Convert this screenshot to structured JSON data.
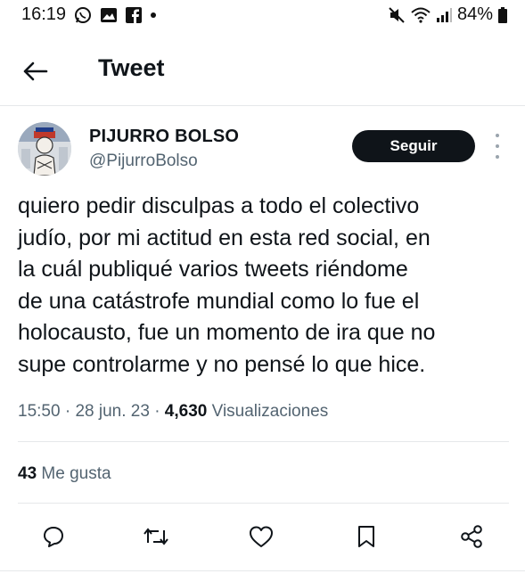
{
  "status_bar": {
    "time": "16:19",
    "left_icons": [
      "whatsapp-icon",
      "gallery-icon",
      "facebook-icon",
      "dot-icon"
    ],
    "right_icons": [
      "mute-icon",
      "wifi-icon",
      "signal-icon"
    ],
    "battery": "84%"
  },
  "header": {
    "title": "Tweet"
  },
  "author": {
    "display_name": "PIJURRO BOLSO",
    "handle": "@PijurroBolso",
    "follow_label": "Seguir"
  },
  "tweet": {
    "lines": [
      "quiero pedir disculpas a todo el colectivo",
      "judío, por mi actitud en esta red social, en",
      "la cuál publiqué varios tweets riéndome",
      "de una catástrofe mundial como lo fue el",
      "holocausto, fue un momento de ira que no",
      "supe controlarme y no pensé lo que hice."
    ],
    "time": "15:50",
    "date": "28 jun. 23",
    "separator": "·",
    "views": "4,630",
    "views_label": "Visualizaciones"
  },
  "likes": {
    "count": "43",
    "label": "Me gusta"
  },
  "actions": [
    "reply-icon",
    "retweet-icon",
    "like-icon",
    "bookmark-icon",
    "share-icon"
  ],
  "colors": {
    "text": "#0f1419",
    "secondary": "#536471",
    "divider": "#e6e8ea",
    "button": "#0f1419"
  }
}
